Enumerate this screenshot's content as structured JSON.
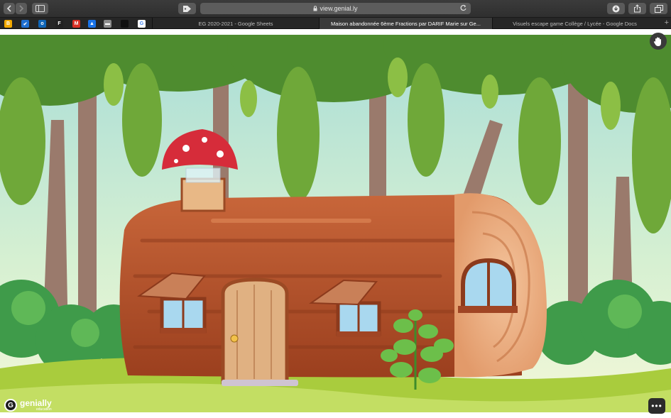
{
  "browser": {
    "url": "view.genial.ly",
    "tabs": [
      {
        "label": "EG 2020-2021 - Google Sheets",
        "active": false
      },
      {
        "label": "Maison abandonnée 6ème Fractions par DARIF Marie sur Ge...",
        "active": true
      },
      {
        "label": "Visuels escape game Collège / Lycée - Google Docs",
        "active": false
      }
    ],
    "new_tab": "+"
  },
  "icons": {
    "back": "chevron-left-icon",
    "forward": "chevron-right-icon",
    "sidebar": "sidebar-icon",
    "extension": "tag-icon",
    "lock": "lock-icon",
    "reload": "reload-icon",
    "download": "download-icon",
    "share": "share-icon",
    "tabs": "tabs-overview-icon",
    "hand": "hand-icon",
    "more": "more-icon",
    "logo": "genially-logo-icon"
  },
  "bookmarks": [
    {
      "name": "bookmark-1",
      "color": "#f2a900",
      "glyph": "B"
    },
    {
      "name": "bookmark-2",
      "color": "#1f6fd1",
      "glyph": "✔"
    },
    {
      "name": "bookmark-3",
      "color": "#0f66b8",
      "glyph": "o"
    },
    {
      "name": "bookmark-4",
      "color": "#222222",
      "glyph": "F"
    },
    {
      "name": "bookmark-gmail",
      "color": "#d93025",
      "glyph": "M"
    },
    {
      "name": "bookmark-drive",
      "color": "#1a73e8",
      "glyph": "▲"
    },
    {
      "name": "bookmark-5",
      "color": "#8c8c8c",
      "glyph": "▬"
    },
    {
      "name": "bookmark-6",
      "color": "#111111",
      "glyph": ""
    },
    {
      "name": "bookmark-google",
      "color": "#ffffff",
      "glyph": "G"
    }
  ],
  "genially": {
    "brand": "genially",
    "sub": "education",
    "more": "•••"
  },
  "colors": {
    "sky": "#cdeccf",
    "log": "#b4532a",
    "log_dark": "#8c3a1c",
    "log_end": "#e9a77a",
    "mushroom": "#d62c3a",
    "grass": "#a9cc3d",
    "bush": "#3f9b4a",
    "leaves": "#4e8c2f"
  }
}
